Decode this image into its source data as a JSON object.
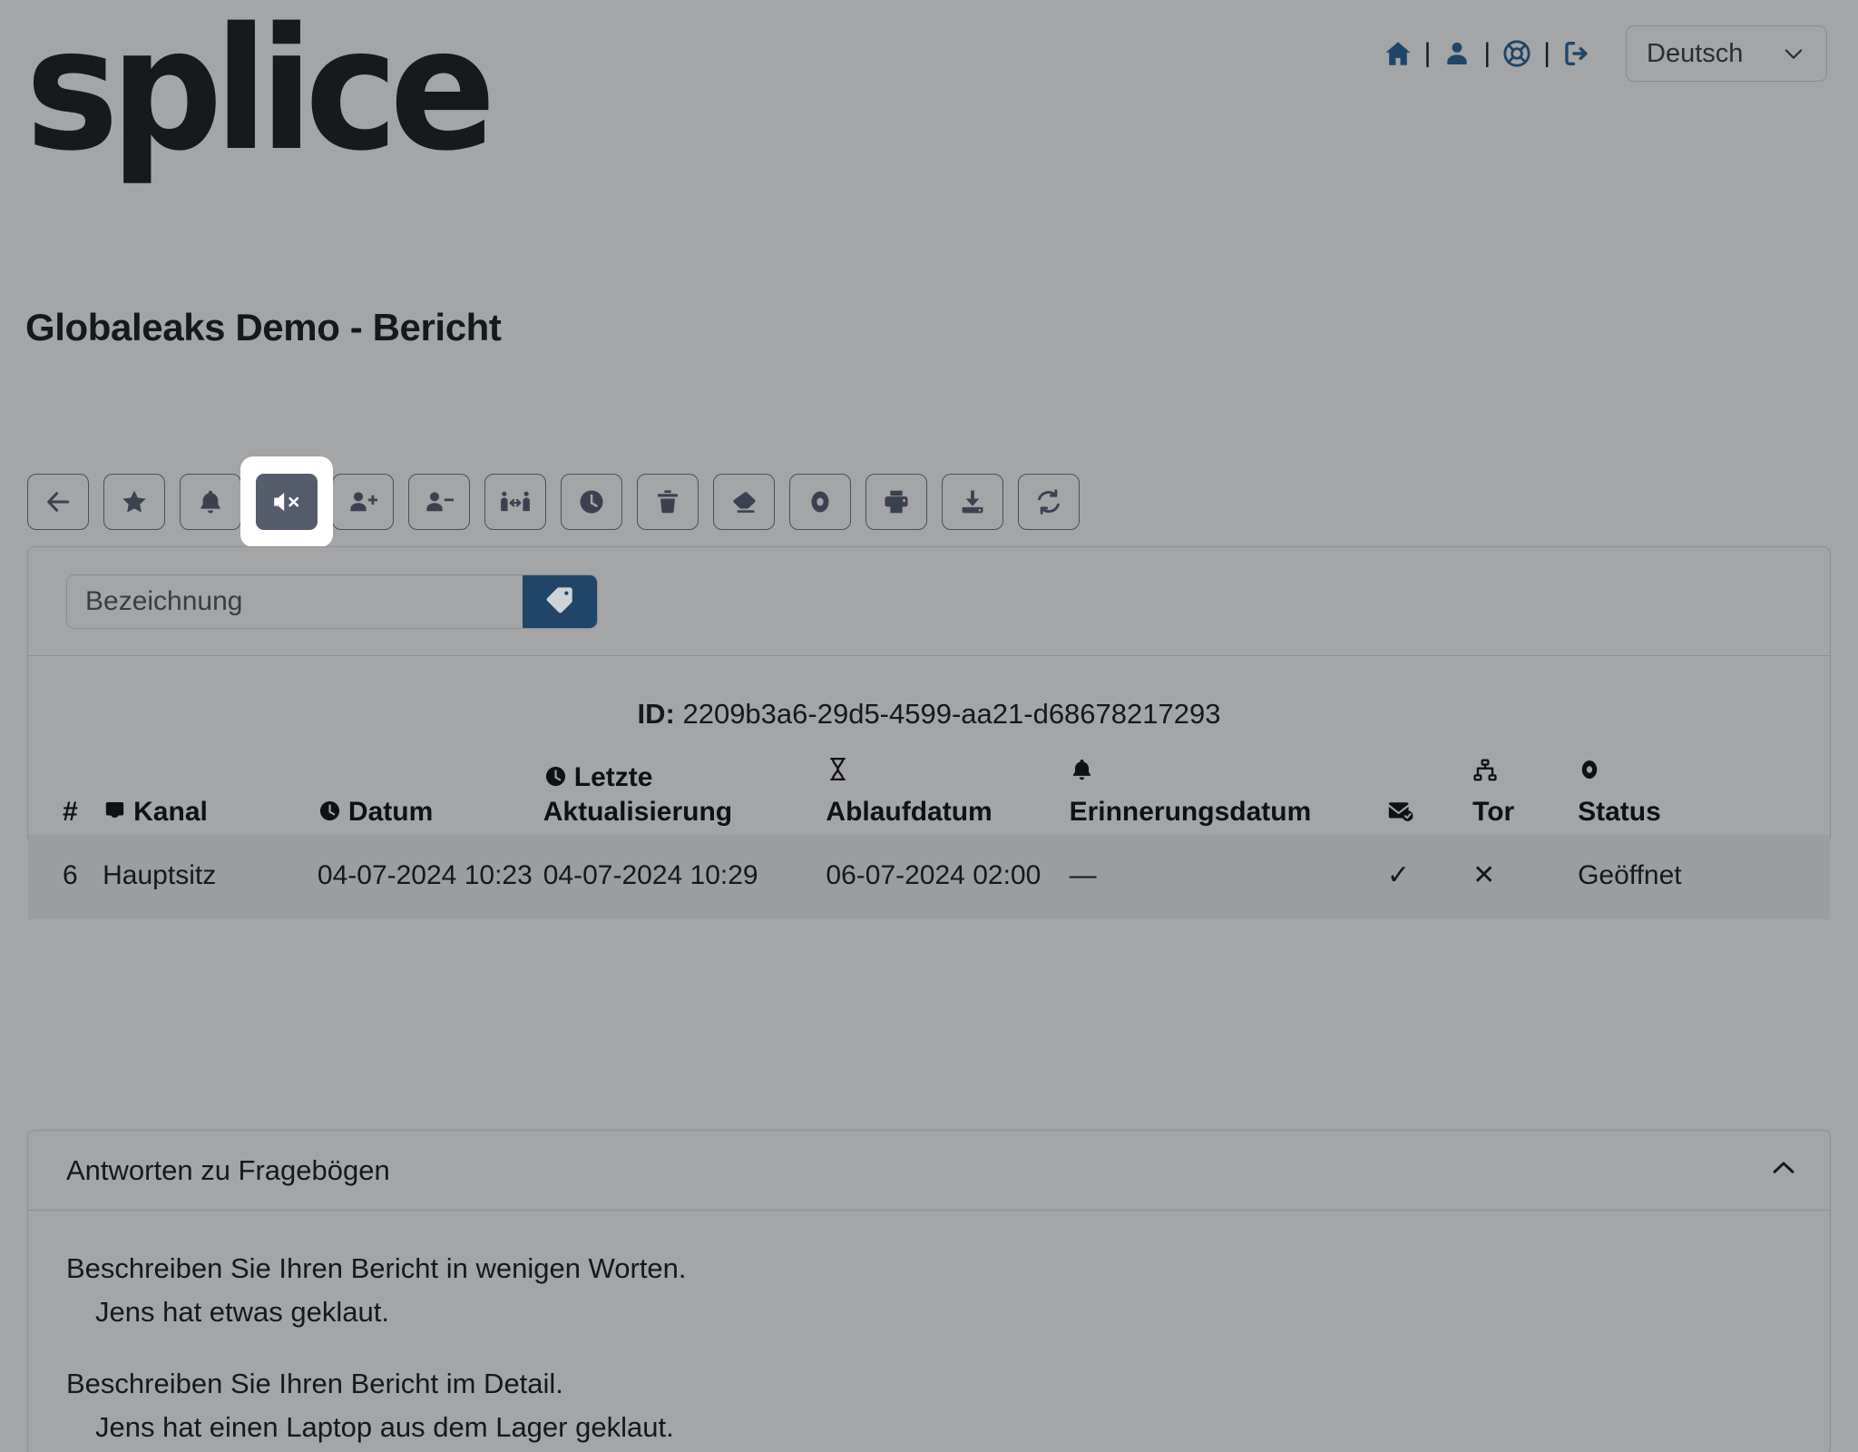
{
  "brand": {
    "logo_text": "splice"
  },
  "header": {
    "icons": [
      {
        "name": "home-icon",
        "label": "Home"
      },
      {
        "name": "user-icon",
        "label": "Konto"
      },
      {
        "name": "lifebuoy-icon",
        "label": "Hilfe"
      },
      {
        "name": "logout-icon",
        "label": "Abmelden"
      }
    ],
    "separator": "|",
    "language": {
      "value": "Deutsch",
      "chevron": "chevron-down-icon"
    }
  },
  "page_title": "Globaleaks Demo - Bericht",
  "toolbar": [
    {
      "name": "back-button",
      "icon": "arrow-left-icon",
      "label": "Zurück",
      "active": false
    },
    {
      "name": "star-button",
      "icon": "star-icon",
      "label": "Favorit",
      "active": false
    },
    {
      "name": "notification-button",
      "icon": "bell-icon",
      "label": "Benachrichtigung",
      "active": false
    },
    {
      "name": "mute-button",
      "icon": "speaker-mute-icon",
      "label": "Stummschalten",
      "active": true
    },
    {
      "name": "add-recipient-button",
      "icon": "user-plus-icon",
      "label": "Empfänger hinzufügen",
      "active": false
    },
    {
      "name": "remove-recipient-button",
      "icon": "user-minus-icon",
      "label": "Empfänger entfernen",
      "active": false
    },
    {
      "name": "transfer-button",
      "icon": "transfer-icon",
      "label": "Übertragen",
      "active": false
    },
    {
      "name": "postpone-button",
      "icon": "clock-icon",
      "label": "Verschieben",
      "active": false
    },
    {
      "name": "delete-button",
      "icon": "trash-icon",
      "label": "Löschen",
      "active": false
    },
    {
      "name": "redact-button",
      "icon": "eraser-icon",
      "label": "Schwärzen",
      "active": false
    },
    {
      "name": "status-button",
      "icon": "record-icon",
      "label": "Status",
      "active": false
    },
    {
      "name": "print-button",
      "icon": "printer-icon",
      "label": "Drucken",
      "active": false
    },
    {
      "name": "download-button",
      "icon": "download-icon",
      "label": "Herunterladen",
      "active": false
    },
    {
      "name": "refresh-button",
      "icon": "refresh-icon",
      "label": "Aktualisieren",
      "active": false
    }
  ],
  "tagbar": {
    "input_value": "",
    "placeholder": "Bezeichnung",
    "button_icon": "tag-icon"
  },
  "report": {
    "id_label": "ID:",
    "id_value": "2209b3a6-29d5-4599-aa21-d68678217293",
    "columns": [
      {
        "key": "num",
        "icon": null,
        "label": "#"
      },
      {
        "key": "chan",
        "icon": "inbox-icon",
        "label": "Kanal"
      },
      {
        "key": "date",
        "icon": "clock-icon",
        "label": "Datum"
      },
      {
        "key": "upd",
        "icon": "clock-icon",
        "label": "Letzte Aktualisierung"
      },
      {
        "key": "exp",
        "icon": "hourglass-icon",
        "label": "Ablaufdatum"
      },
      {
        "key": "rem",
        "icon": "bell-icon",
        "label": "Erinnerungsdatum"
      },
      {
        "key": "mail",
        "icon": "mail-check-icon",
        "label": ""
      },
      {
        "key": "tor",
        "icon": "network-icon",
        "label": "Tor"
      },
      {
        "key": "stat",
        "icon": "record-icon",
        "label": "Status"
      }
    ],
    "rows": [
      {
        "num": "6",
        "chan": "Hauptsitz",
        "date": "04-07-2024 10:23",
        "upd": "04-07-2024 10:29",
        "exp": "06-07-2024 02:00",
        "rem": "—",
        "mail": "✓",
        "tor": "✕",
        "stat": "Geöffnet"
      }
    ]
  },
  "accordion": {
    "title": "Antworten zu Fragebögen",
    "chevron": "chevron-up-icon",
    "expanded": true,
    "items": [
      {
        "question": "Beschreiben Sie Ihren Bericht in wenigen Worten.",
        "answer": "Jens hat etwas geklaut."
      },
      {
        "question": "Beschreiben Sie Ihren Bericht im Detail.",
        "answer": "Jens hat einen Laptop aus dem Lager geklaut."
      }
    ]
  },
  "colors": {
    "background": "#a3a5a7",
    "accent_blue": "#1f4667",
    "active_button": "#555c6b",
    "text": "#16181b",
    "border": "#8e9093"
  }
}
